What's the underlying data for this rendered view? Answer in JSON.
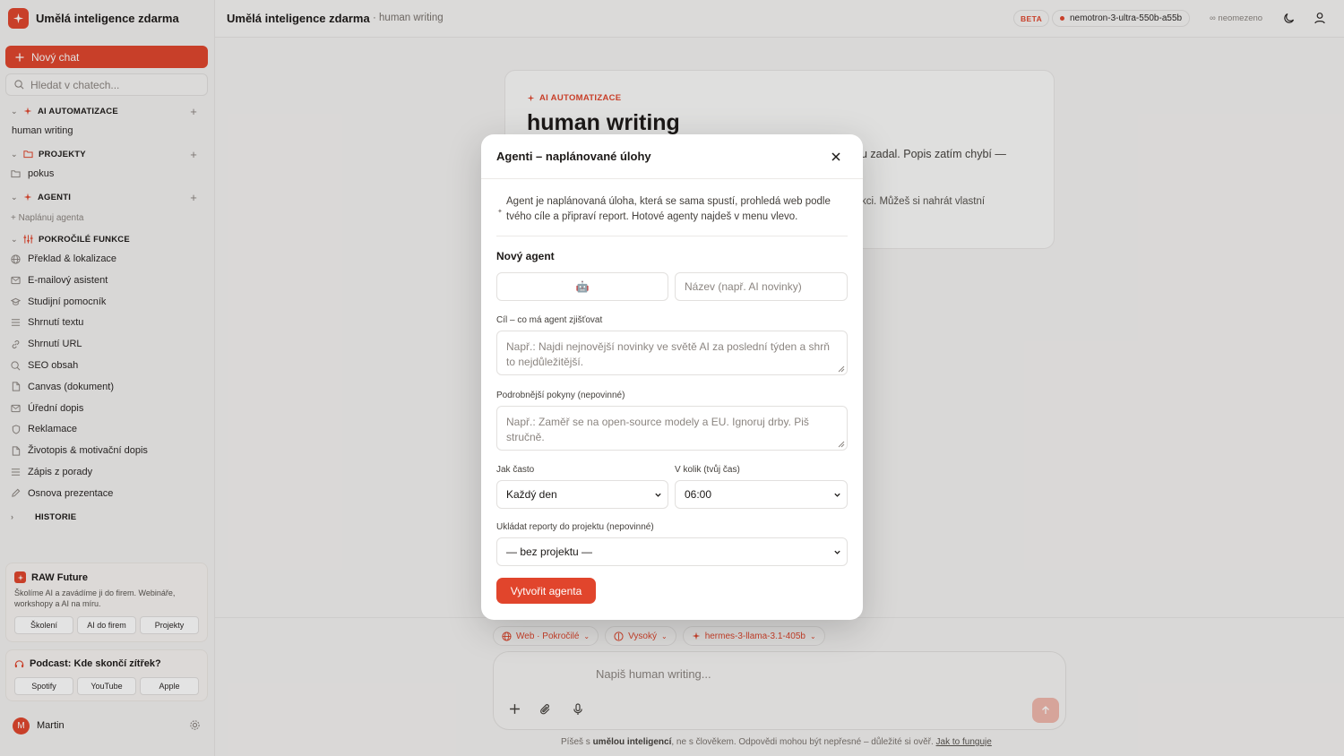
{
  "app": {
    "name": "Umělá inteligence zdarma"
  },
  "sidebar": {
    "new_chat": "Nový chat",
    "search_placeholder": "Hledat v chatech...",
    "sections": {
      "ai": {
        "label": "AI AUTOMATIZACE",
        "items": [
          "human writing"
        ]
      },
      "projects": {
        "label": "PROJEKTY",
        "items": [
          "pokus"
        ]
      },
      "agents": {
        "label": "AGENTI",
        "schedule": "+ Naplánuj agenta"
      },
      "advanced": {
        "label": "POKROČILÉ FUNKCE",
        "items": [
          {
            "label": "Překlad & lokalizace",
            "icon": "globe-icon"
          },
          {
            "label": "E-mailový asistent",
            "icon": "mail-icon"
          },
          {
            "label": "Studijní pomocník",
            "icon": "graduation-cap-icon"
          },
          {
            "label": "Shrnutí textu",
            "icon": "list-icon"
          },
          {
            "label": "Shrnutí URL",
            "icon": "link-icon"
          },
          {
            "label": "SEO obsah",
            "icon": "search-icon"
          },
          {
            "label": "Canvas (dokument)",
            "icon": "document-icon"
          },
          {
            "label": "Úřední dopis",
            "icon": "mail-icon"
          },
          {
            "label": "Reklamace",
            "icon": "shield-icon"
          },
          {
            "label": "Životopis & motivační dopis",
            "icon": "document-icon"
          },
          {
            "label": "Zápis z porady",
            "icon": "list-icon"
          },
          {
            "label": "Osnova prezentace",
            "icon": "pencil-icon"
          }
        ]
      },
      "history": {
        "label": "HISTORIE"
      }
    },
    "promo": {
      "title": "RAW Future",
      "text": "Školíme AI a zavádíme ji do firem. Webináře, workshopy a AI na míru.",
      "buttons": [
        "Školení",
        "AI do firem",
        "Projekty"
      ]
    },
    "podcast": {
      "title": "Podcast: Kde skončí zítřek?",
      "buttons": [
        "Spotify",
        "YouTube",
        "Apple"
      ]
    },
    "user": {
      "name": "Martin",
      "initial": "M"
    }
  },
  "topbar": {
    "title": "Umělá inteligence zdarma",
    "subtitle": "· human writing",
    "beta": "BETA",
    "model": "nemotron-3-ultra-550b-a55b",
    "limit": "∞ neomezeno"
  },
  "card": {
    "eyebrow": "AI AUTOMATIZACE",
    "title": "human writing",
    "text1_end": "u zadal. Popis zatím chybí —",
    "text2_end": "kci. Můžeš si nahrát vlastní"
  },
  "composer": {
    "chips": [
      {
        "label": "Web · Pokročilé",
        "icon": "globe-icon"
      },
      {
        "label": "Vysoký",
        "icon": "brain-icon"
      },
      {
        "label": "hermes-3-llama-3.1-405b",
        "icon": "sparkle-icon"
      }
    ],
    "placeholder": "Napiš human writing...",
    "footer_pre": "Píšeš s ",
    "footer_bold": "umělou inteligencí",
    "footer_mid": ", ne s člověkem. Odpovědi mohou být nepřesné – důležité si ověř. ",
    "footer_link": "Jak to funguje"
  },
  "modal": {
    "title": "Agenti – naplánované úlohy",
    "info": "Agent je naplánovaná úloha, která se sama spustí, prohledá web podle tvého cíle a připraví report. Hotové agenty najdeš v menu vlevo.",
    "new_agent": "Nový agent",
    "emoji": "🤖",
    "name_placeholder": "Název (např. AI novinky)",
    "goal_label": "Cíl – co má agent zjišťovat",
    "goal_placeholder": "Např.: Najdi nejnovější novinky ve světě AI za poslední týden a shrň to nejdůležitější.",
    "details_label": "Podrobnější pokyny (nepovinné)",
    "details_placeholder": "Např.: Zaměř se na open-source modely a EU. Ignoruj drby. Piš stručně.",
    "freq_label": "Jak často",
    "freq_value": "Každý den",
    "time_label": "V kolik (tvůj čas)",
    "time_value": "06:00",
    "project_label": "Ukládat reporty do projektu (nepovinné)",
    "project_value": "— bez projektu —",
    "create": "Vytvořit agenta"
  },
  "colors": {
    "accent": "#e1452c",
    "accent_soft": "#f1b8ac"
  }
}
